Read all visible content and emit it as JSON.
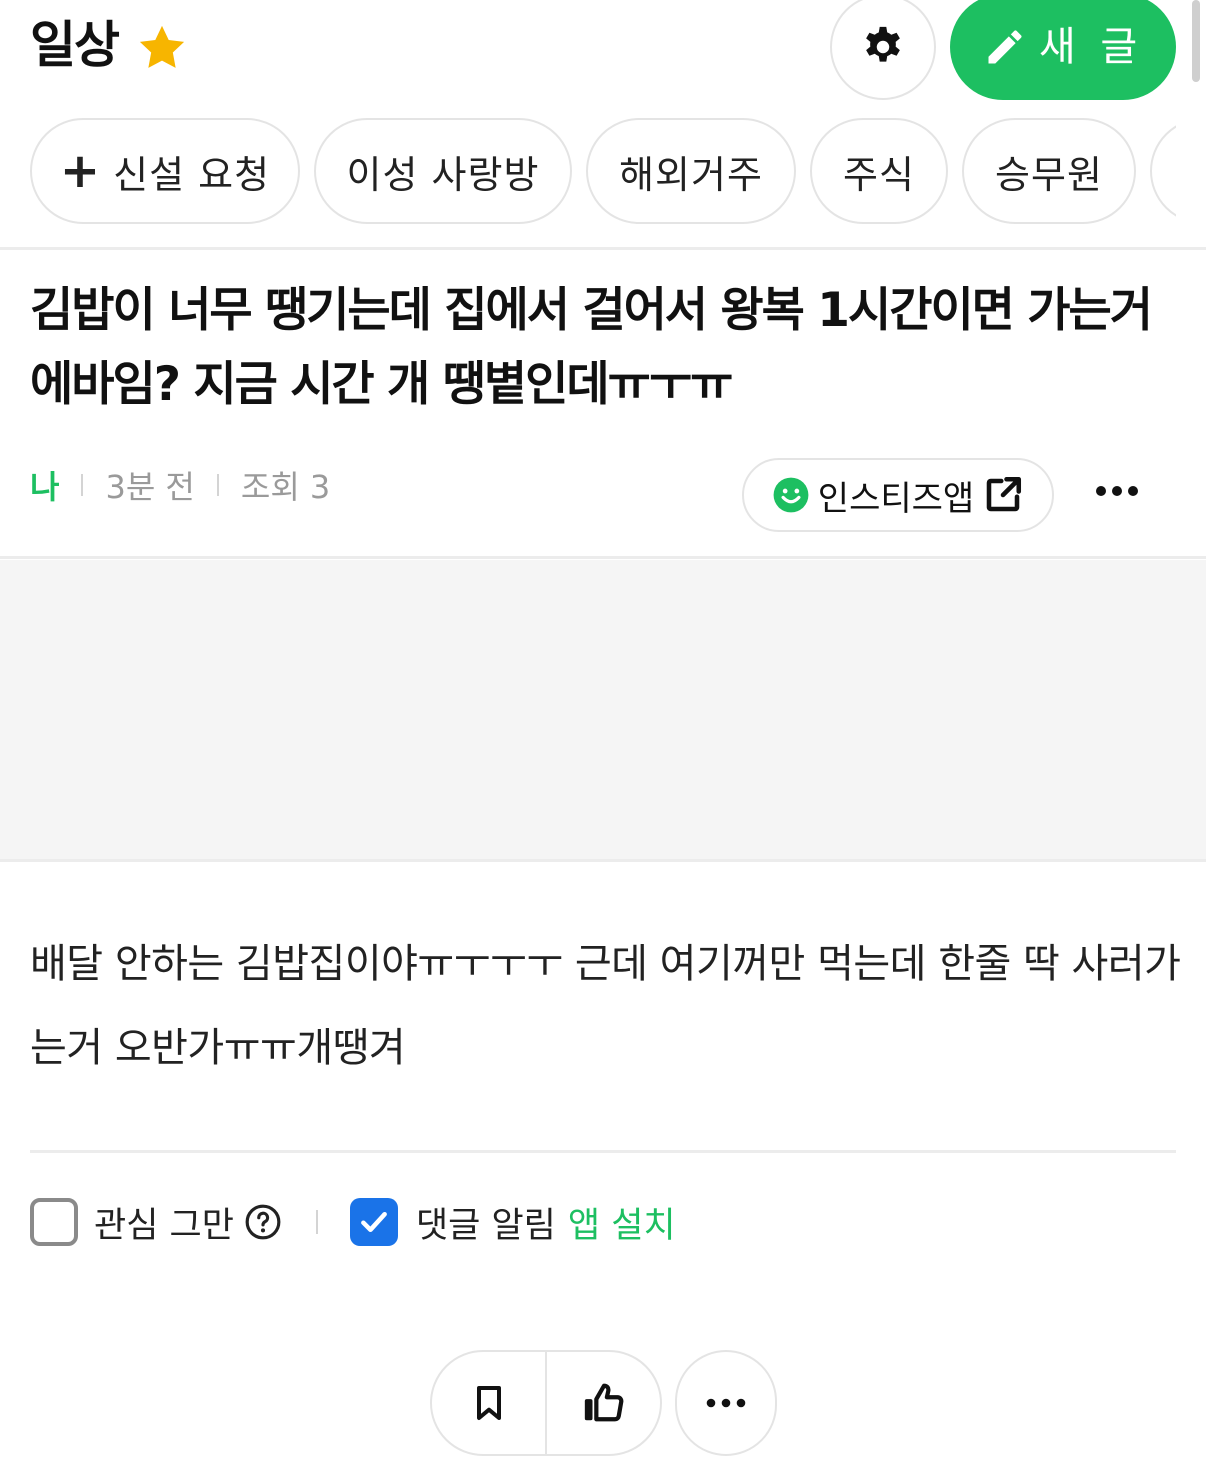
{
  "header": {
    "board_title": "일상",
    "new_post_label": "새 글"
  },
  "tags": [
    {
      "label": "신설 요청",
      "prefix": "+"
    },
    {
      "label": "이성 사랑방"
    },
    {
      "label": "해외거주"
    },
    {
      "label": "주식"
    },
    {
      "label": "승무원"
    },
    {
      "label": ""
    }
  ],
  "post": {
    "title": "김밥이 너무 땡기는데 집에서 걸어서 왕복 1시간이면 가는거 에바임? 지금 시간 개 땡볕인데ㅠㅜㅠ",
    "author": "나",
    "time": "3분 전",
    "views": "조회 3",
    "app_badge": "인스티즈앱",
    "body": "배달 안하는 김밥집이야ㅠㅜㅜㅜ 근데 여기꺼만 먹는데 한줄 딱 사러가는거 오반가ㅠㅠ개땡겨"
  },
  "options": {
    "interest_stop": "관심 그만",
    "interest_stop_checked": false,
    "comment_alert": "댓글 알림",
    "comment_alert_checked": true,
    "install_link": "앱 설치"
  },
  "colors": {
    "brand_green": "#1dbf61",
    "checkbox_blue": "#1a73e8",
    "star_yellow": "#f7b500"
  },
  "icons": {
    "star": "star-icon",
    "settings": "gear-icon",
    "new_post": "pencil-icon",
    "app_badge": "smiley-icon",
    "external": "external-link-icon",
    "more": "more-icon",
    "help": "question-icon",
    "bookmark": "bookmark-icon",
    "like": "thumbs-up-icon"
  }
}
